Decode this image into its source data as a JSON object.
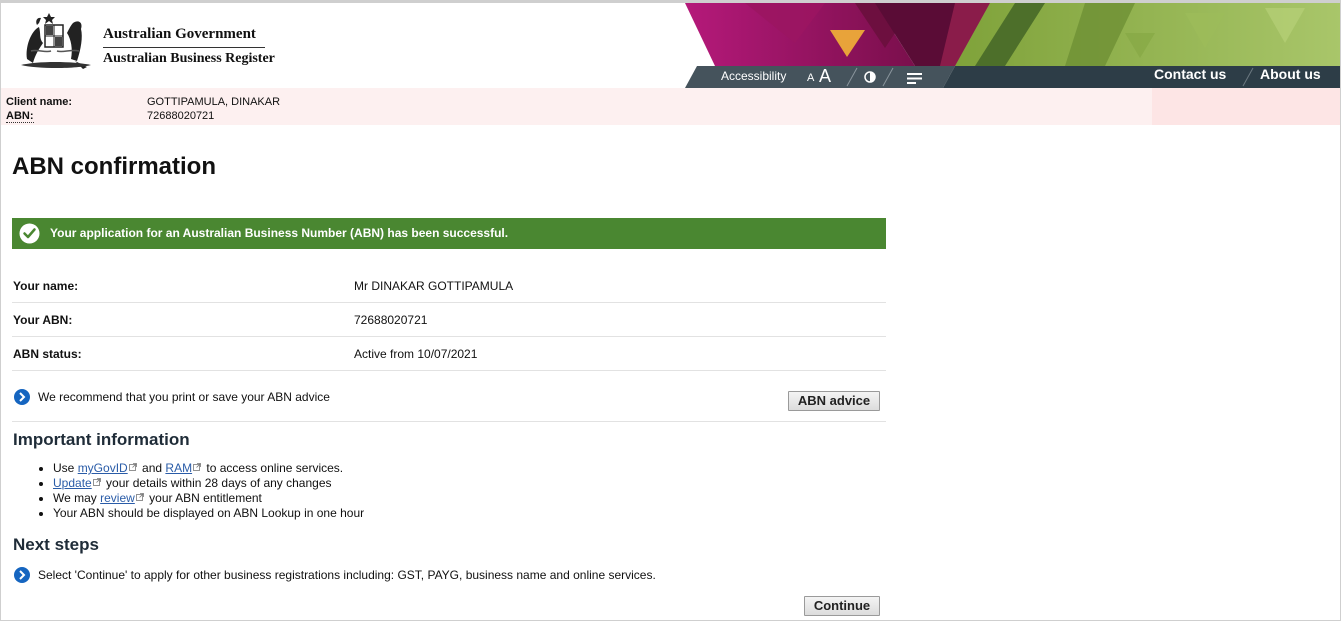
{
  "header": {
    "gov_title": "Australian Government",
    "register_name": "Australian Business Register",
    "accessibility_label": "Accessibility",
    "font_small": "A",
    "font_large": "A",
    "contact_label": "Contact us",
    "about_label": "About us",
    "icons": [
      "coat-of-arms",
      "contrast-icon",
      "menu-icon"
    ]
  },
  "client": {
    "name_label": "Client name:",
    "name_value": "GOTTIPAMULA, DINAKAR",
    "abn_label": "ABN:",
    "abn_value": "72688020721"
  },
  "page": {
    "title": "ABN confirmation",
    "success_message": "Your application for an Australian Business Number (ABN) has been successful."
  },
  "details": [
    {
      "label": "Your name:",
      "value": "Mr DINAKAR GOTTIPAMULA"
    },
    {
      "label": "Your ABN:",
      "value": "72688020721"
    },
    {
      "label": "ABN status:",
      "value": "Active from 10/07/2021"
    }
  ],
  "recommend": {
    "text": "We recommend that you print or save your ABN advice",
    "button": "ABN advice"
  },
  "important": {
    "heading": "Important information",
    "item1": {
      "pre": "Use ",
      "link1": "myGovID",
      "mid": " and ",
      "link2": "RAM",
      "post": " to access online services."
    },
    "item2": {
      "link": "Update",
      "post": " your details within 28 days of any changes"
    },
    "item3": {
      "pre": "We may ",
      "link": "review",
      "post": " your ABN entitlement"
    },
    "item4": "Your ABN should be displayed on ABN Lookup in one hour"
  },
  "next_steps": {
    "heading": "Next steps",
    "text": "Select 'Continue' to apply for other business registrations including: GST, PAYG, business name and online services.",
    "button": "Continue"
  },
  "colors": {
    "success_green": "#4a8731",
    "nav_dark": "#2d3d47",
    "link_blue": "#2a5ca8",
    "arrow_blue": "#1565c0"
  }
}
